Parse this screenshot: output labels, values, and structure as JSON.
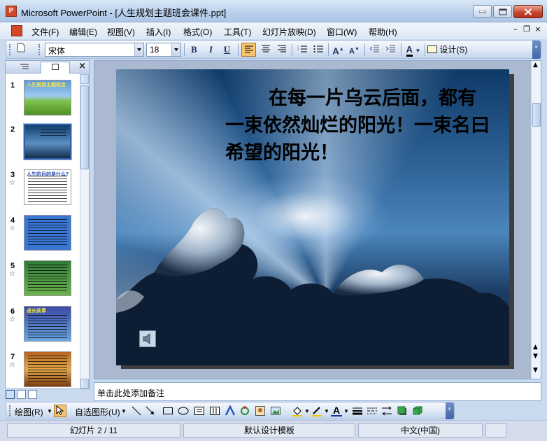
{
  "window": {
    "title": "Microsoft PowerPoint - [人生规划主题班会课件.ppt]",
    "app_icon_letter": "P"
  },
  "menu": {
    "items": [
      "文件(F)",
      "编辑(E)",
      "视图(V)",
      "插入(I)",
      "格式(O)",
      "工具(T)",
      "幻灯片放映(D)",
      "窗口(W)",
      "帮助(H)"
    ]
  },
  "toolbar": {
    "font_name": "宋体",
    "font_size": "18",
    "bold": "B",
    "italic": "I",
    "underline": "U",
    "design_label": "设计(S)"
  },
  "outline_pane": {
    "close_glyph": "×",
    "slides": [
      {
        "number": "1",
        "has_transition_icon": false,
        "thumb_title": "人生规划主题班会"
      },
      {
        "number": "2",
        "has_transition_icon": false,
        "selected": true
      },
      {
        "number": "3",
        "has_transition_icon": true,
        "thumb_title": "人生的目的是什么?"
      },
      {
        "number": "4",
        "has_transition_icon": true
      },
      {
        "number": "5",
        "has_transition_icon": true
      },
      {
        "number": "6",
        "has_transition_icon": true,
        "thumb_title": "成长故事"
      },
      {
        "number": "7",
        "has_transition_icon": true
      }
    ]
  },
  "slide": {
    "text": "在每一片乌云后面，都有一束依然灿烂的阳光！一束名曰希望的阳光！"
  },
  "notes": {
    "placeholder": "单击此处添加备注"
  },
  "drawing_toolbar": {
    "draw_label": "绘图(R)",
    "autoshapes_label": "自选图形(U)"
  },
  "status": {
    "slide_position": "幻灯片 2 / 11",
    "template": "默认设计模板",
    "language": "中文(中国)"
  },
  "colors": {
    "titlebar": "#b9d0ec",
    "accent_orange": "#f7c56d",
    "app_red": "#d24726"
  }
}
